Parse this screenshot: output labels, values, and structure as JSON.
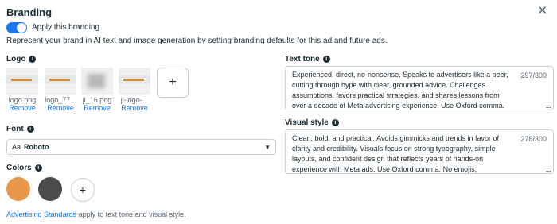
{
  "header": {
    "title": "Branding",
    "close_icon": "close-icon"
  },
  "toggle": {
    "label": "Apply this branding",
    "on": true,
    "color": "#1877f2"
  },
  "description": "Represent your brand in AI text and image generation by setting branding defaults for this ad and future ads.",
  "logo": {
    "label": "Logo",
    "remove_label": "Remove",
    "items": [
      {
        "filename": "logo.png"
      },
      {
        "filename": "logo_77..."
      },
      {
        "filename": "jl_16.png"
      },
      {
        "filename": "jl-logo-..."
      }
    ],
    "add_label": "+"
  },
  "font": {
    "label": "Font",
    "prefix": "Aa",
    "value": "Roboto",
    "caret": "▼"
  },
  "colors": {
    "label": "Colors",
    "swatches": [
      "#e8964a",
      "#4b4b4b"
    ],
    "add_label": "+"
  },
  "footer": {
    "link": "Advertising Standards",
    "text": " apply to text tone and visual style."
  },
  "text_tone": {
    "label": "Text tone",
    "count": "297/300",
    "value": "Experienced, direct, no-nonsense. Speaks to advertisers like a peer, cutting through hype with clear, grounded advice. Challenges assumptions, favors practical strategies, and shares lessons from over a decade of Meta advertising experience. Use Oxford comma. No emojis, hashtags, em or en dashes."
  },
  "visual_style": {
    "label": "Visual style",
    "count": "278/300",
    "value": "Clean, bold, and practical. Avoids gimmicks and trends in favor of clarity and credibility. Visuals focus on strong typography, simple layouts, and confident design that reflects years of hands-on experience with Meta ads. Use Oxford comma. No emojis, hashtags, em or en dashes."
  }
}
